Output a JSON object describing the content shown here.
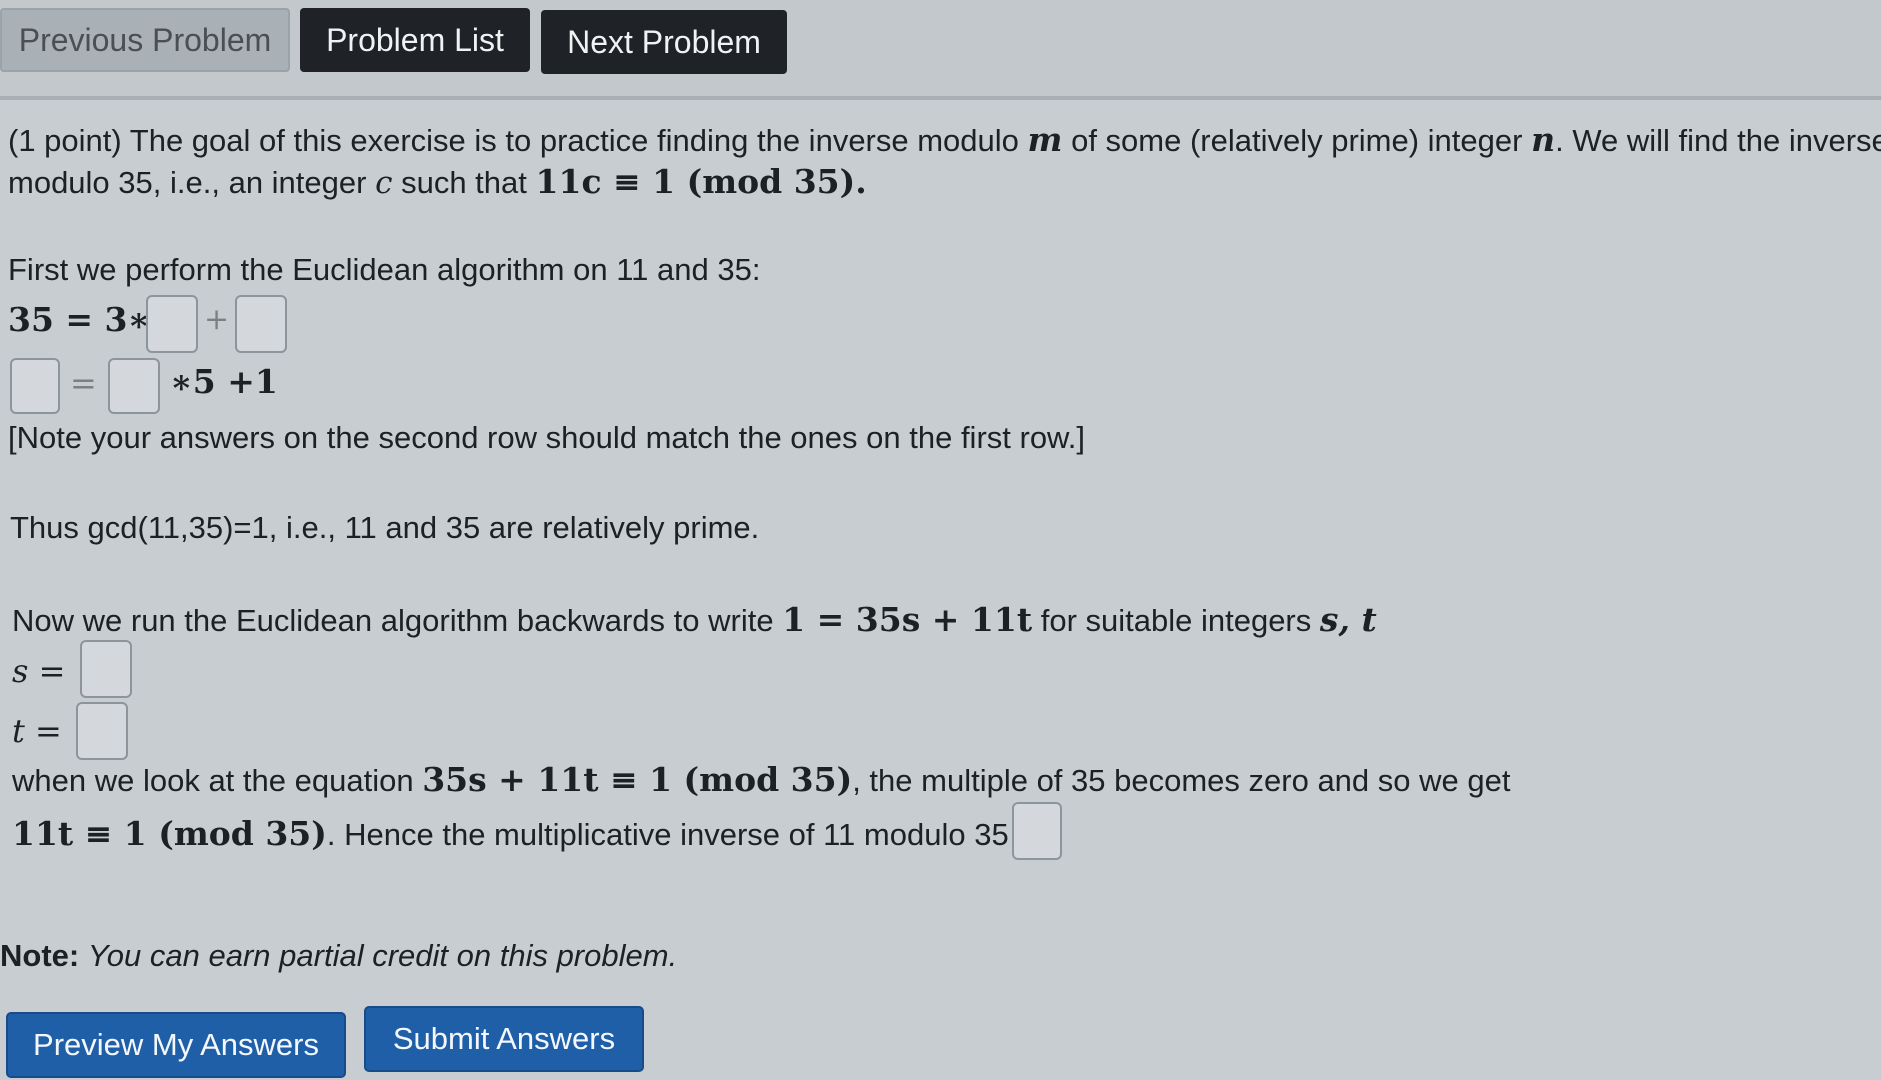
{
  "nav": {
    "previous": "Previous Problem",
    "list": "Problem List",
    "next": "Next Problem"
  },
  "problem": {
    "intro1_a": "(1 point) The goal of this exercise is to practice finding the inverse modulo",
    "intro1_m": "m",
    "intro1_b": "of some (relatively prime) integer",
    "intro1_n": "n",
    "intro1_c": ". We will find the inverse",
    "intro2_a": "modulo 35, i.e., an integer",
    "intro2_c": "c",
    "intro2_b": "such that",
    "intro2_math": "11c ≡ 1 (mod  35).",
    "euclid_intro": "First we perform the Euclidean algorithm on 11 and 35:",
    "row1_lhs": "35 = 3∗",
    "row1_plus": "+",
    "row2_eq": "=",
    "row2_rhs": "∗5 +1",
    "note_rows": "[Note your answers on the second row should match the ones on the first row.]",
    "gcd_text": "Thus gcd(11,35)=1, i.e., 11 and 35 are relatively prime.",
    "back_a": "Now we run the Euclidean algorithm backwards to write",
    "back_math": "1 = 35s + 11t",
    "back_b": "for suitable integers",
    "back_vars": "s, t",
    "s_label": "s =",
    "t_label": "t =",
    "when_a": "when we look at the equation",
    "when_math": "35s + 11t ≡ 1 (mod 35)",
    "when_b": ", the multiple of 35 becomes zero and so we get",
    "hence_math": "11t ≡ 1 (mod 35)",
    "hence_b": ". Hence the multiplicative inverse of 11 modulo 35 is",
    "note_label": "Note:",
    "note_text": "You can earn partial credit on this problem."
  },
  "footer": {
    "preview": "Preview My Answers",
    "submit": "Submit Answers"
  }
}
